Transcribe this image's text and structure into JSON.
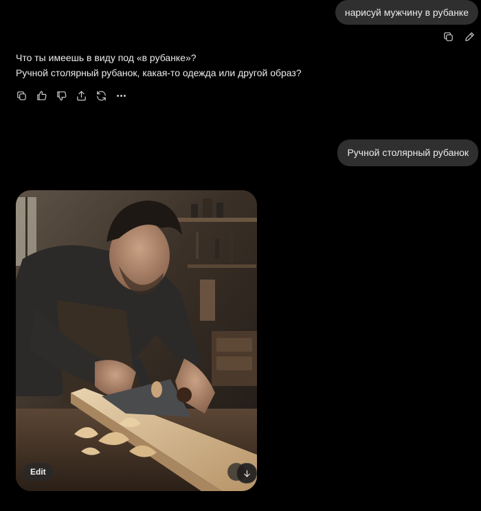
{
  "conversation": {
    "user_message_1": "нарисуй мужчину в рубанке",
    "assistant_reply": {
      "line_1": "Что ты имеешь в виду под «в рубанке»?",
      "line_2": "Ручной столярный рубанок, какая-то одежда или другой образ?"
    },
    "user_message_2": "Ручной столярный рубанок"
  },
  "user_actions": {
    "icons": [
      "copy-icon",
      "edit-pencil-icon"
    ]
  },
  "assistant_actions": {
    "icons": [
      "copy-icon",
      "thumbs-up-icon",
      "thumbs-down-icon",
      "share-icon",
      "regenerate-icon",
      "more-icon"
    ]
  },
  "generated_image": {
    "edit_label": "Edit",
    "icons": [
      "expand-icon",
      "scroll-down-icon"
    ]
  },
  "colors": {
    "background": "#000000",
    "bubble": "#2f2f2f",
    "text": "#ececec",
    "icon": "#d0d0d0"
  }
}
